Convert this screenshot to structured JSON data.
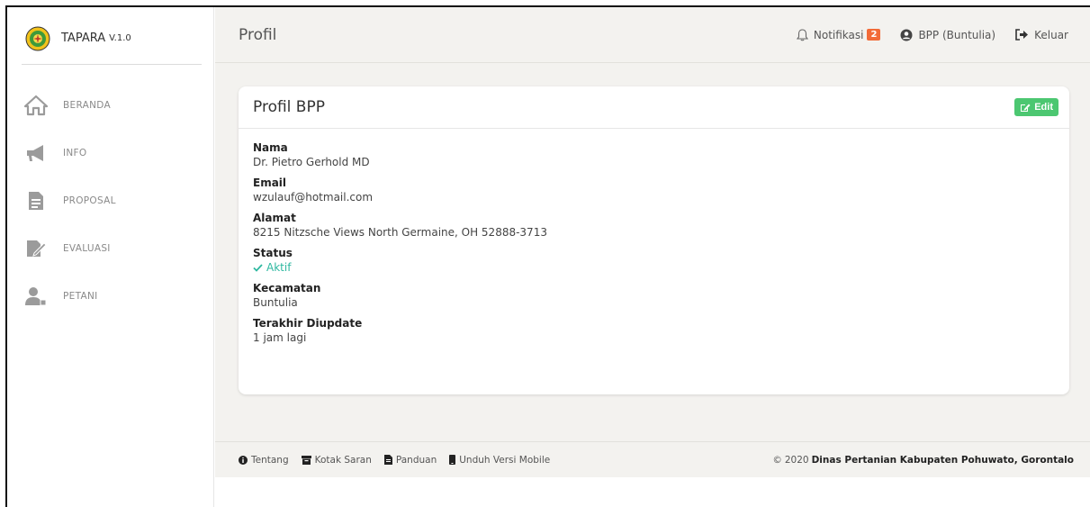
{
  "sidebar": {
    "brand_name": "TAPARA",
    "brand_version": "V.1.0",
    "items": [
      {
        "label": "BERANDA",
        "icon": "home-icon"
      },
      {
        "label": "INFO",
        "icon": "megaphone-icon"
      },
      {
        "label": "PROPOSAL",
        "icon": "document-icon"
      },
      {
        "label": "EVALUASI",
        "icon": "signature-icon"
      },
      {
        "label": "PETANI",
        "icon": "user-icon"
      }
    ]
  },
  "header": {
    "title": "Profil",
    "notifications_label": "Notifikasi",
    "notifications_count": "2",
    "user_label": "BPP (Buntulia)",
    "logout_label": "Keluar"
  },
  "card": {
    "title": "Profil BPP",
    "edit_label": "Edit",
    "fields": [
      {
        "label": "Nama",
        "value": "Dr. Pietro Gerhold MD"
      },
      {
        "label": "Email",
        "value": "wzulauf@hotmail.com"
      },
      {
        "label": "Alamat",
        "value": "8215 Nitzsche Views North Germaine, OH 52888-3713"
      },
      {
        "label": "Status",
        "value": "Aktif"
      },
      {
        "label": "Kecamatan",
        "value": "Buntulia"
      },
      {
        "label": "Terakhir Diupdate",
        "value": "1 jam lagi"
      }
    ]
  },
  "footer": {
    "links": [
      "Tentang",
      "Kotak Saran",
      "Panduan",
      "Unduh Versi Mobile"
    ],
    "copyright_year": "2020",
    "copyright_org": "Dinas Pertanian Kabupaten Pohuwato, Gorontalo"
  },
  "colors": {
    "accent_green": "#4cc771",
    "status_teal": "#2eb8a0",
    "badge_orange": "#f26b38",
    "main_bg": "#f3f2ef"
  }
}
